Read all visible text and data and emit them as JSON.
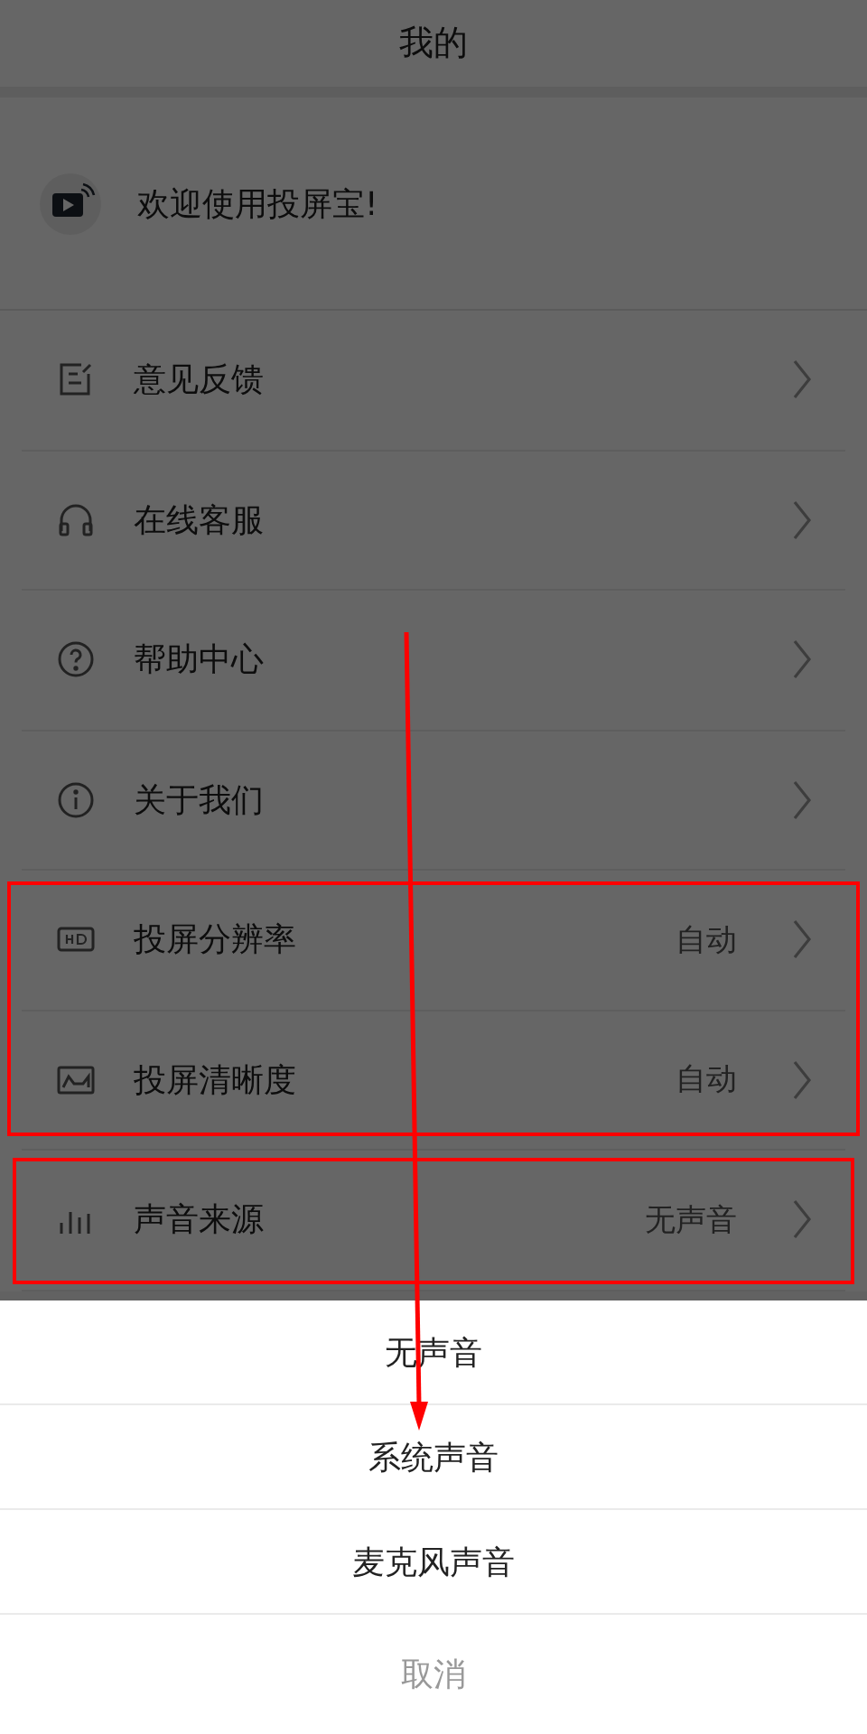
{
  "header": {
    "title": "我的"
  },
  "welcome": {
    "text": "欢迎使用投屏宝!"
  },
  "menu": [
    {
      "label": "意见反馈"
    },
    {
      "label": "在线客服"
    },
    {
      "label": "帮助中心"
    },
    {
      "label": "关于我们"
    },
    {
      "label": "投屏分辨率",
      "value": "自动"
    },
    {
      "label": "投屏清晰度",
      "value": "自动"
    },
    {
      "label": "声音来源",
      "value": "无声音"
    }
  ],
  "action_sheet": {
    "options": [
      "无声音",
      "系统声音",
      "麦克风声音"
    ],
    "cancel": "取消"
  }
}
